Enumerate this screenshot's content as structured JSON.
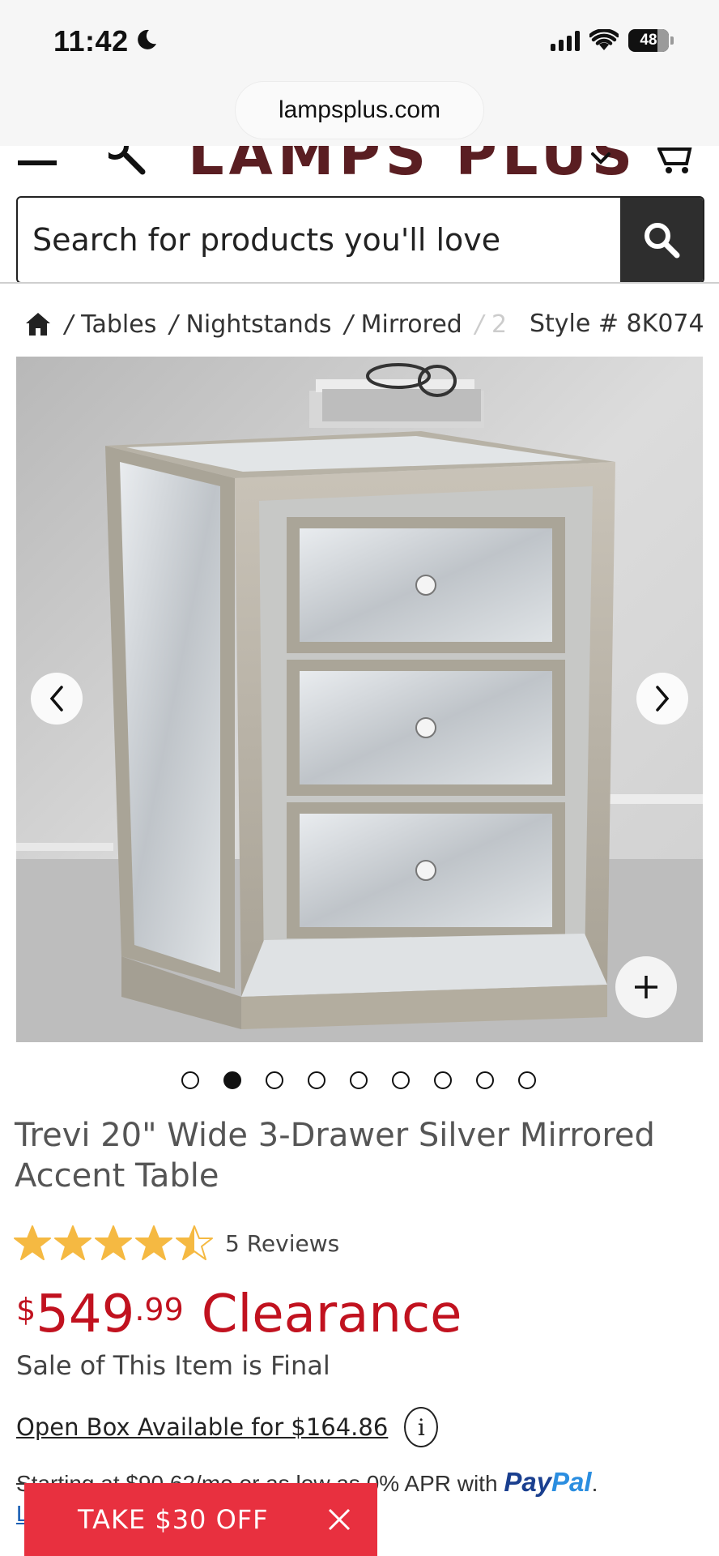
{
  "status_bar": {
    "time": "11:42",
    "battery": "48"
  },
  "browser": {
    "url": "lampsplus.com"
  },
  "header": {
    "logo_text": "LAMPS PLUS"
  },
  "search": {
    "placeholder": "Search for products you'll love"
  },
  "breadcrumb": {
    "items": [
      "Tables",
      "Nightstands",
      "Mirrored",
      "2"
    ],
    "style_number": "Style # 8K074"
  },
  "gallery": {
    "image_count": 9,
    "active_index": 1
  },
  "product": {
    "title": "Trevi 20\" Wide 3-Drawer Silver Mirrored Accent Table",
    "rating": 4.5,
    "reviews": "5 Reviews",
    "price_currency": "$",
    "price_dollars": "549",
    "price_cents": ".99",
    "price_label": "Clearance",
    "sale_note": "Sale of This Item is Final",
    "open_box": "Open Box Available for $164.86",
    "info_glyph": "i"
  },
  "financing": {
    "prefix": "Starting at $90.62/mo or as low as",
    "apr_text": "0% APR with",
    "paypal_pay": "Pay",
    "paypal_pal": "Pal",
    "suffix": ".",
    "learn_more": "L"
  },
  "promo": {
    "label": "TAKE $30 OFF"
  },
  "colors": {
    "accent_red": "#c1121f",
    "promo_red": "#e8303f",
    "star_gold": "#f5b942",
    "paypal_blue": "#1a3f8f"
  },
  "icons": [
    "moon-icon",
    "signal-icon",
    "wifi-icon",
    "battery-icon",
    "menu-icon",
    "search-icon",
    "chevron-down-icon",
    "cart-icon",
    "home-icon",
    "chevron-left-icon",
    "chevron-right-icon",
    "plus-icon",
    "info-icon",
    "close-icon",
    "star-icon"
  ]
}
